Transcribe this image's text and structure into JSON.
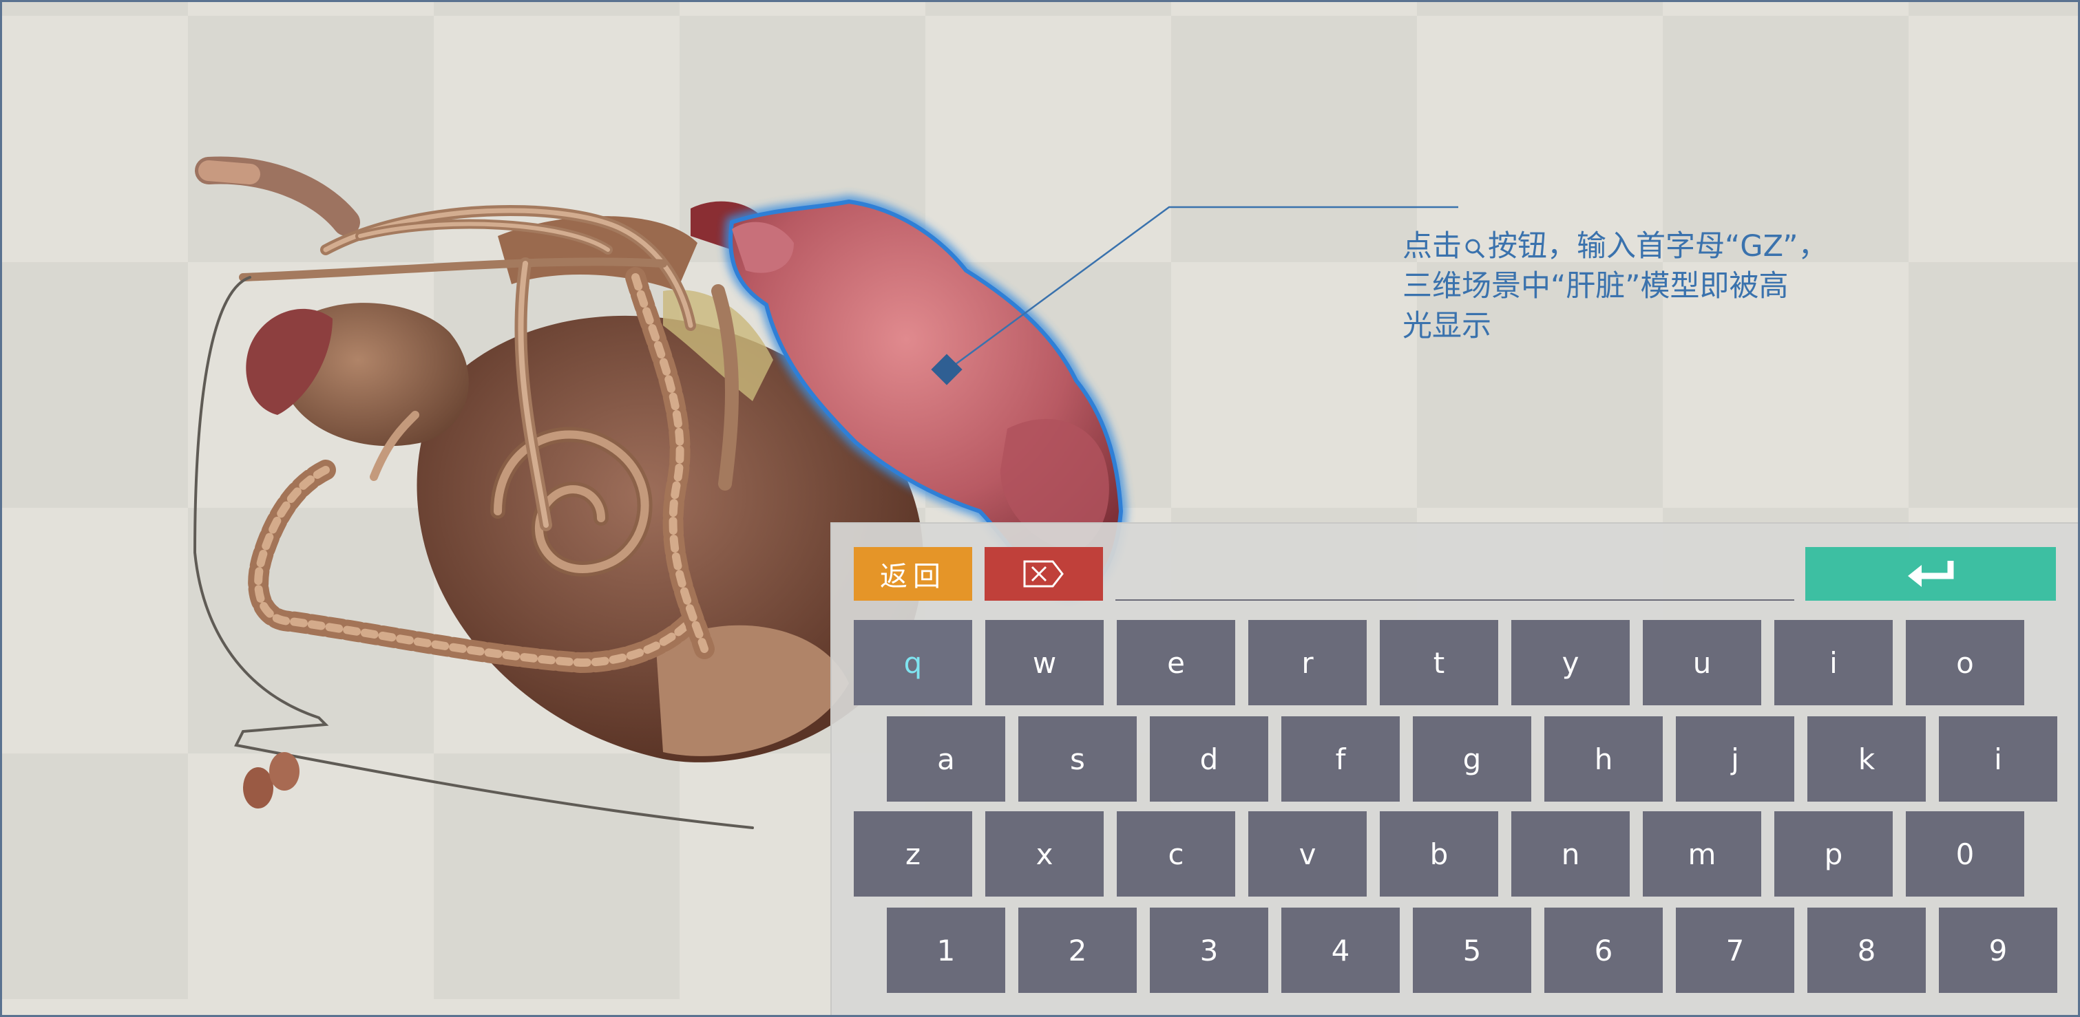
{
  "callout": {
    "line1_before_icon": "点击",
    "line1_after_icon": "按钮，输入首字母“GZ”，",
    "line2": "三维场景中“肝脏”模型即被高",
    "line3": "光显示",
    "icon": "search-icon"
  },
  "keyboard": {
    "back_label": "返回",
    "backspace_icon": "backspace-icon",
    "enter_icon": "enter-icon",
    "input_value": "",
    "row1": [
      "q",
      "w",
      "e",
      "r",
      "t",
      "y",
      "u",
      "i",
      "o"
    ],
    "row2": [
      "a",
      "s",
      "d",
      "f",
      "g",
      "h",
      "j",
      "k",
      "i"
    ],
    "row3": [
      "z",
      "x",
      "c",
      "v",
      "b",
      "n",
      "m",
      "p",
      "0"
    ],
    "row4": [
      "1",
      "2",
      "3",
      "4",
      "5",
      "6",
      "7",
      "8",
      "9"
    ],
    "active_key": "q"
  },
  "colors": {
    "back_button": "#e59528",
    "backspace_button": "#c0403a",
    "enter_button": "#3dbfa2",
    "key": "#6a6b7a",
    "highlight": "#3a8fe0",
    "callout": "#3a72ad"
  }
}
